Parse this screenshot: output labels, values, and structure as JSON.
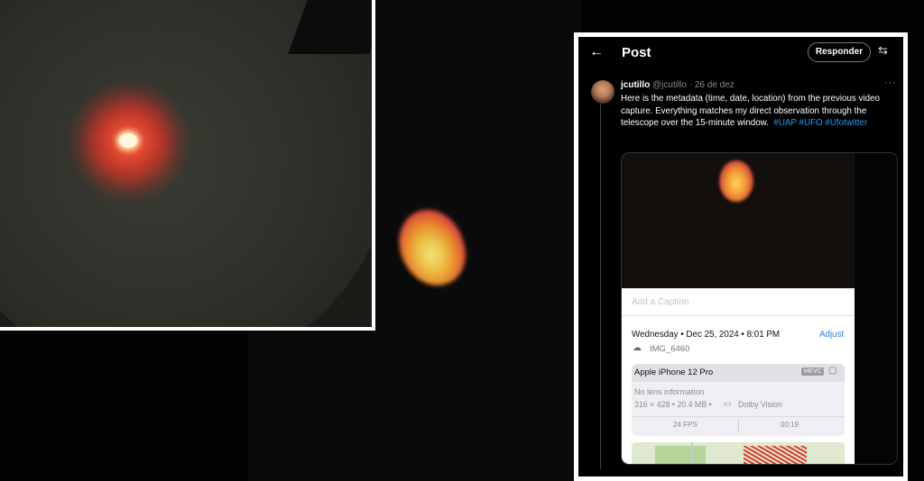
{
  "tweet": {
    "header_title": "Post",
    "reply_label": "Responder",
    "display_name": "jcutillo",
    "handle": "@jcutillo",
    "date": "· 26 de dez",
    "text": "Here is the metadata (time, date, location) from the previous video capture. Everything matches my direct observation through the telescope over the 15-minute window.",
    "hashtags": [
      "#UAP",
      "#UFO",
      "#Ufotwitter"
    ]
  },
  "media_info": {
    "caption_placeholder": "Add a Caption",
    "datetime": "Wednesday • Dec 25, 2024 • 8:01 PM",
    "adjust_label": "Adjust",
    "filename": "IMG_6460",
    "device": "Apple iPhone 12 Pro",
    "codec_badge": "HEVC",
    "lens": "No lens information",
    "specs": "316 × 428  •  20.4 MB  •",
    "dolby": "Dolby Vision",
    "fps": "24 FPS",
    "duration": "00:19"
  },
  "icons": {
    "back": "arrow-left-icon",
    "filter": "sliders-icon",
    "more": "more-horizontal-icon",
    "cloud": "cloud-icon",
    "camera": "video-camera-icon",
    "display": "display-icon"
  },
  "colors": {
    "link_blue": "#1d9bf0",
    "adjust_blue": "#2f7bf5",
    "orb_red": "#d9473b",
    "orb_yellow": "#ecc24a"
  }
}
